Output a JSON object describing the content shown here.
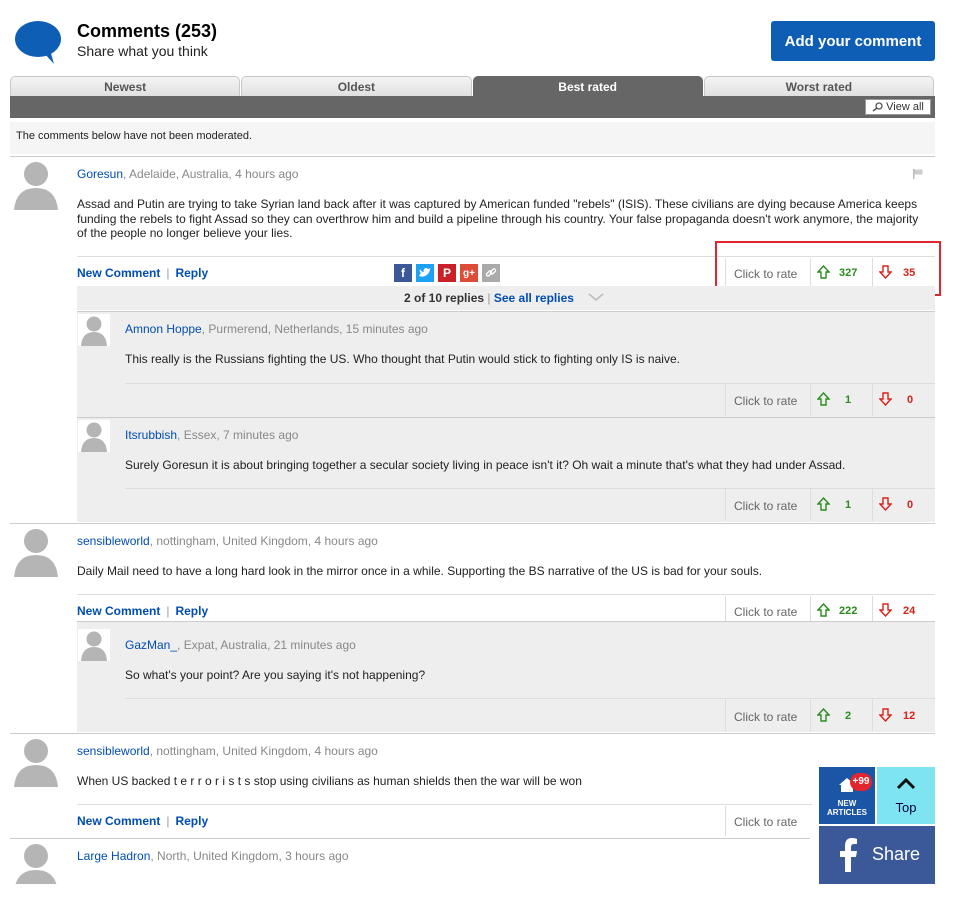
{
  "header": {
    "title": "Comments (253)",
    "subtitle": "Share what you think",
    "add_comment_label": "Add your comment"
  },
  "tabs": [
    {
      "label": "Newest",
      "active": false
    },
    {
      "label": "Oldest",
      "active": false
    },
    {
      "label": "Best rated",
      "active": true
    },
    {
      "label": "Worst rated",
      "active": false
    }
  ],
  "view_all_label": "View all",
  "notice": "The comments below have not been moderated.",
  "labels": {
    "new_comment": "New Comment",
    "reply": "Reply",
    "click_to_rate": "Click to rate"
  },
  "comments": [
    {
      "author": "Goresun",
      "meta": ", Adelaide, Australia, 4 hours ago",
      "text": "Assad and Putin are trying to take Syrian land back after it was captured by American funded \"rebels\" (ISIS). These civilians are dying because America keeps funding the rebels to fight Assad so they can overthrow him and build a pipeline through his country. Your false propaganda doesn't work anymore, the majority of the people no longer believe your lies.",
      "up": "327",
      "down": "35",
      "replies_count": "2 of 10 replies",
      "see_all": "See all replies",
      "replies": [
        {
          "author": "Amnon Hoppe",
          "meta": ", Purmerend, Netherlands, 15 minutes ago",
          "text": "This really is the Russians fighting the US. Who thought that Putin would stick to fighting only IS is naive.",
          "up": "1",
          "down": "0"
        },
        {
          "author": "Itsrubbish",
          "meta": ", Essex, 7 minutes ago",
          "text": "Surely Goresun it is about bringing together a secular society living in peace isn't it? Oh wait a minute that's what they had under Assad.",
          "up": "1",
          "down": "0"
        }
      ]
    },
    {
      "author": "sensibleworld",
      "meta": ", nottingham, United Kingdom, 4 hours ago",
      "text": "Daily Mail need to have a long hard look in the mirror once in a while. Supporting the BS narrative of the US is bad for your souls.",
      "up": "222",
      "down": "24",
      "replies": [
        {
          "author": "GazMan_",
          "meta": ", Expat, Australia, 21 minutes ago",
          "text": "So what's your point? Are you saying it's not happening?",
          "up": "2",
          "down": "12"
        }
      ]
    },
    {
      "author": "sensibleworld",
      "meta": ", nottingham, United Kingdom, 4 hours ago",
      "text": "When US backed t e r r o r i s t s stop using civilians as human shields then the war will be won"
    },
    {
      "author": "Large Hadron",
      "meta": ", North, United Kingdom, 3 hours ago",
      "text": ""
    }
  ],
  "floating": {
    "new_articles_badge": "+99",
    "new_articles_label_1": "NEW",
    "new_articles_label_2": "ARTICLES",
    "top_label": "Top",
    "share_label": "Share"
  },
  "colors": {
    "brand_blue": "#0f5eb6",
    "upvote_green": "#2a8b1f",
    "downvote_red": "#d8231a",
    "facebook_blue": "#3b5998",
    "highlight_red": "#e1262e"
  }
}
